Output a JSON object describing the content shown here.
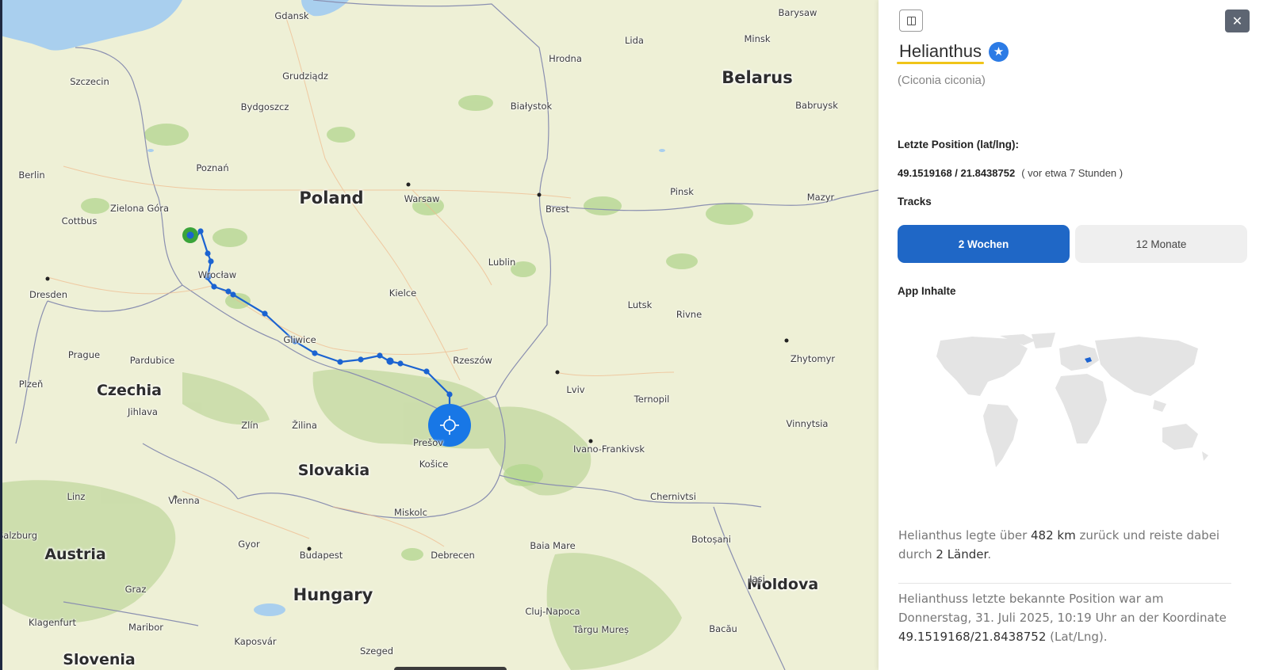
{
  "map": {
    "countries": [
      {
        "key": "poland",
        "name": "Poland"
      },
      {
        "key": "belarus",
        "name": "Belarus"
      },
      {
        "key": "czechia",
        "name": "Czechia"
      },
      {
        "key": "slovakia",
        "name": "Slovakia"
      },
      {
        "key": "austria",
        "name": "Austria"
      },
      {
        "key": "hungary",
        "name": "Hungary"
      },
      {
        "key": "moldova",
        "name": "Moldova"
      },
      {
        "key": "slovenia",
        "name": "Slovenia"
      }
    ],
    "cities": [
      "Gdansk",
      "Barysaw",
      "Lida",
      "Minsk",
      "Hrodna",
      "Szczecin",
      "Grudziądz",
      "Bydgoszcz",
      "Białystok",
      "Babruysk",
      "Berlin",
      "Poznań",
      "Warsaw",
      "Brest",
      "Pinsk",
      "Mazyr",
      "Zielona Góra",
      "Cottbus",
      "Wrocław",
      "Lublin",
      "Dresden",
      "Kielce",
      "Lutsk",
      "Rivne",
      "Gliwice",
      "Rzeszów",
      "Prague",
      "Pardubice",
      "Zhytomyr",
      "Plzeň",
      "Jihlava",
      "Lviv",
      "Ternopil",
      "Zlín",
      "Žilina",
      "Vinnytsia",
      "Ivano-Frankivsk",
      "Prešov",
      "Košice",
      "Linz",
      "Vienna",
      "Chernivtsi",
      "Miskolc",
      "Salzburg",
      "Gyor",
      "Budapest",
      "Debrecen",
      "Baia Mare",
      "Botoșani",
      "Graz",
      "Iași",
      "Klagenfurt",
      "Maribor",
      "Cluj-Napoca",
      "Târgu Mureș",
      "Bacău",
      "Kaposvár",
      "Szeged"
    ]
  },
  "panel": {
    "bird_name": "Helianthus",
    "species": "(Ciconia ciconia)",
    "last_position_label": "Letzte Position (lat/lng):",
    "coords": "49.1519168 / 21.8438752",
    "time_ago": "( vor etwa 7 Stunden )",
    "tracks_label": "Tracks",
    "track_tabs": [
      "2 Wochen",
      "12 Monate"
    ],
    "active_tab": "2 Wochen",
    "app_content_label": "App Inhalte",
    "summary": {
      "p1_a": "Helianthus legte über ",
      "p1_km": "482 km",
      "p1_b": " zurück und reiste dabei durch ",
      "p1_countries": "2 Länder",
      "p1_c": ".",
      "p2_a": "Helianthuss letzte bekannte Position war am Donnerstag, 31. Juli 2025, 10:19 Uhr an der Koordinate ",
      "p2_coord": "49.1519168/21.8438752",
      "p2_b": " (Lat/Lng)."
    },
    "icons": {
      "collapse": "sidebar-collapse-icon",
      "close": "close-icon",
      "badge": "star-icon",
      "locate": "crosshair-icon"
    },
    "colors": {
      "accent": "#1f67c6",
      "track": "#1b63d1",
      "start": "#3aa43a",
      "highlight": "#f0c419",
      "star": "#2c7be5"
    }
  }
}
